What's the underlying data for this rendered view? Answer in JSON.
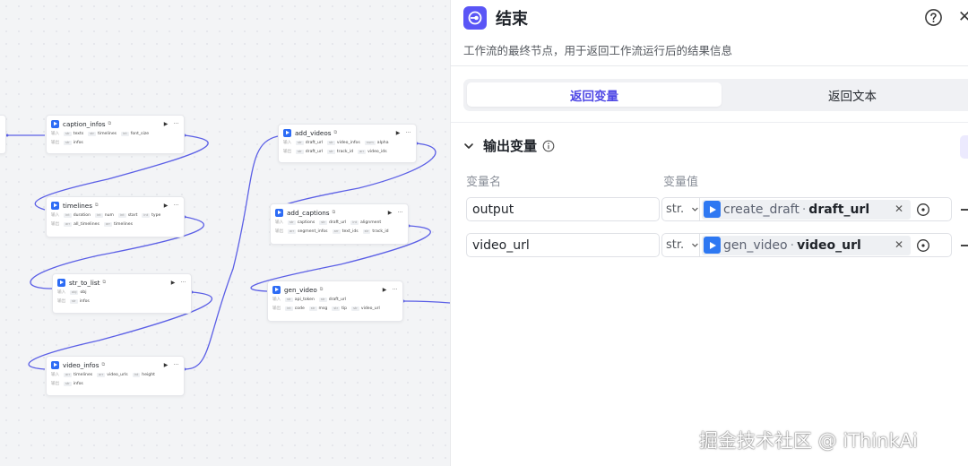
{
  "colors": {
    "accent": "#5a55f6",
    "edge": "#5b5fe6",
    "node_icon": "#2d6cf5"
  },
  "canvas": {
    "nodes": [
      {
        "title": "caption_infos",
        "input_label": "输入",
        "output_label": "输出",
        "inputs": [
          "texts",
          "timelines",
          "font_size"
        ],
        "outputs": [
          "infos"
        ]
      },
      {
        "title": "timelines",
        "input_label": "输入",
        "output_label": "输出",
        "inputs": [
          "duration",
          "num",
          "start",
          "type"
        ],
        "outputs": [
          "all_timelines",
          "timelines"
        ]
      },
      {
        "title": "str_to_list",
        "input_label": "输入",
        "output_label": "输出",
        "inputs": [
          "obj"
        ],
        "outputs": [
          "infos"
        ]
      },
      {
        "title": "video_infos",
        "input_label": "输入",
        "output_label": "输出",
        "inputs": [
          "timelines",
          "video_urls",
          "height"
        ],
        "outputs": [
          "infos"
        ]
      },
      {
        "title": "add_videos",
        "input_label": "输入",
        "output_label": "输出",
        "inputs": [
          "draft_url",
          "video_infos",
          "alpha"
        ],
        "outputs": [
          "draft_url",
          "track_id",
          "video_ids"
        ]
      },
      {
        "title": "add_captions",
        "input_label": "输入",
        "output_label": "输出",
        "inputs": [
          "captions",
          "draft_url",
          "alignment"
        ],
        "outputs": [
          "segment_infos",
          "text_ids",
          "track_id"
        ]
      },
      {
        "title": "gen_video",
        "input_label": "输入",
        "output_label": "输出",
        "inputs": [
          "api_token",
          "draft_url"
        ],
        "outputs": [
          "code",
          "msg",
          "tip",
          "video_url"
        ]
      }
    ]
  },
  "panel": {
    "title": "结束",
    "description": "工作流的最终节点，用于返回工作流运行后的结果信息",
    "tabs": [
      {
        "label": "返回变量",
        "active": true
      },
      {
        "label": "返回文本",
        "active": false
      }
    ],
    "section_title": "输出变量",
    "col_name": "变量名",
    "col_value": "变量值",
    "variables": [
      {
        "name": "output",
        "type": "str.",
        "ref_node": "create_draft",
        "ref_field": "draft_url"
      },
      {
        "name": "video_url",
        "type": "str.",
        "ref_node": "gen_video",
        "ref_field": "video_url"
      }
    ]
  },
  "watermark": "掘金技术社区 @ iThinkAi"
}
